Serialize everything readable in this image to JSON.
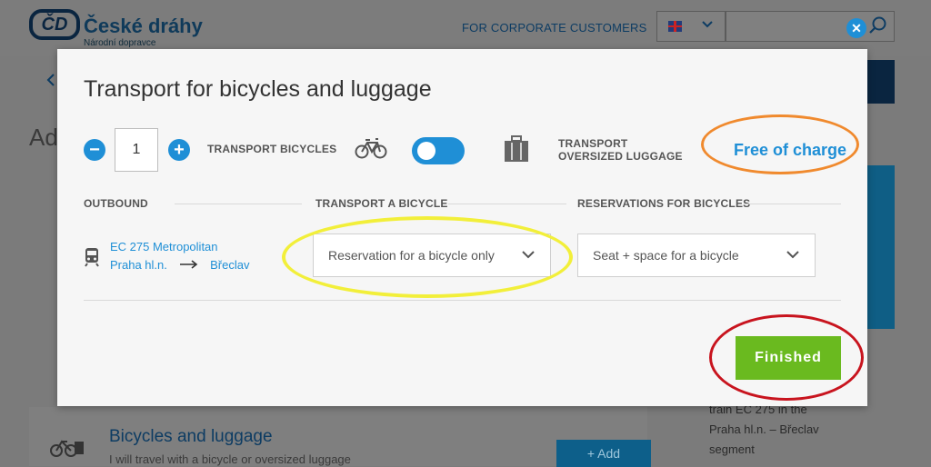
{
  "header": {
    "brand_name": "České dráhy",
    "brand_tagline": "Národní dopravce",
    "corporate_link": "FOR CORPORATE CUSTOMERS"
  },
  "background": {
    "page_title_fragment": "Ad",
    "card": {
      "title": "Bicycles and luggage",
      "subtitle": "I will travel with a bicycle or oversized luggage",
      "add_button": "+ Add"
    },
    "side_info": [
      "train EC 275 in the",
      "Praha hl.n. – Břeclav",
      "segment"
    ]
  },
  "modal": {
    "title": "Transport for bicycles and luggage",
    "quantity": "1",
    "transport_bicycles_label": "TRANSPORT BICYCLES",
    "transport_luggage_label_line1": "TRANSPORT",
    "transport_luggage_label_line2": "OVERSIZED LUGGAGE",
    "price": "Free of charge",
    "columns": {
      "outbound": "OUTBOUND",
      "transport_bicycle": "TRANSPORT A BICYCLE",
      "reservations": "RESERVATIONS FOR BICYCLES"
    },
    "train": "EC 275 Metropolitan",
    "from": "Praha hl.n.",
    "to": "Břeclav",
    "transport_select_value": "Reservation for a bicycle only",
    "reservation_select_value": "Seat + space for a bicycle",
    "finish_button": "Finished"
  },
  "colors": {
    "accent": "#1f8fd6",
    "finish": "#6aba1f",
    "annotation_orange": "#f08a2e",
    "annotation_yellow": "#f2ef3a",
    "annotation_red": "#c8141e"
  },
  "icons": [
    "logo-icon",
    "flag-uk-icon",
    "chevron-down-icon",
    "search-icon",
    "close-icon",
    "minus-icon",
    "plus-icon",
    "bicycle-icon",
    "luggage-icon",
    "train-icon",
    "arrow-right-icon"
  ]
}
